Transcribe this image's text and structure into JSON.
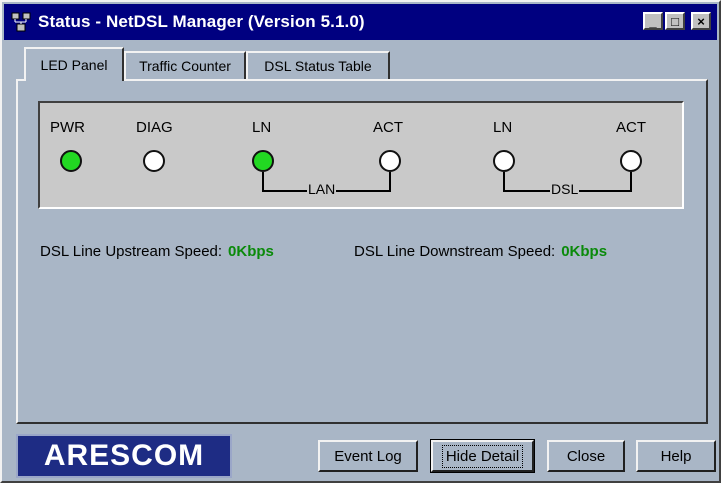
{
  "window": {
    "title": "Status - NetDSL Manager (Version 5.1.0)",
    "controls": {
      "minimize": "_",
      "maximize": "□",
      "close": "×"
    }
  },
  "tabs": [
    {
      "label": "LED Panel",
      "active": true
    },
    {
      "label": "Traffic Counter",
      "active": false
    },
    {
      "label": "DSL Status Table",
      "active": false
    }
  ],
  "leds": [
    {
      "label": "PWR",
      "state": "on",
      "color": "#22d822"
    },
    {
      "label": "DIAG",
      "state": "off",
      "color": "#ffffff"
    },
    {
      "label": "LN",
      "state": "on",
      "color": "#22d822"
    },
    {
      "label": "ACT",
      "state": "off",
      "color": "#ffffff"
    },
    {
      "label": "LN",
      "state": "off",
      "color": "#ffffff"
    },
    {
      "label": "ACT",
      "state": "off",
      "color": "#ffffff"
    }
  ],
  "groups": {
    "lan": "LAN",
    "dsl": "DSL"
  },
  "speeds": {
    "upstream_label": "DSL Line Upstream Speed:",
    "upstream_value": "0Kbps",
    "downstream_label": "DSL Line Downstream Speed:",
    "downstream_value": "0Kbps",
    "value_color": "#0a8a0a"
  },
  "logo": {
    "text": "ARESCOM"
  },
  "buttons": {
    "event_log": "Event Log",
    "hide_detail": "Hide Detail",
    "close": "Close",
    "help": "Help"
  }
}
